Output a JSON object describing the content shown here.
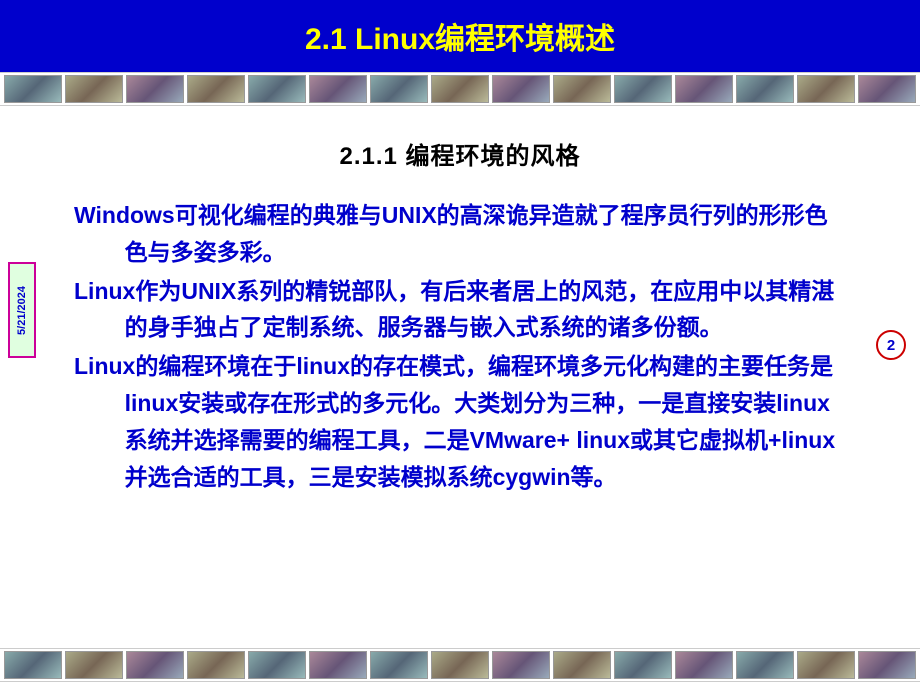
{
  "header": {
    "title": "2.1 Linux编程环境概述"
  },
  "subtitle": "2.1.1 编程环境的风格",
  "paragraphs": [
    "Windows可视化编程的典雅与UNIX的高深诡异造就了程序员行列的形形色色与多姿多彩。",
    "Linux作为UNIX系列的精锐部队，有后来者居上的风范，在应用中以其精湛的身手独占了定制系统、服务器与嵌入式系统的诸多份额。",
    "Linux的编程环境在于linux的存在模式，编程环境多元化构建的主要任务是linux安装或存在形式的多元化。大类划分为三种，一是直接安装linux系统并选择需要的编程工具，二是VMware+ linux或其它虚拟机+linux并选合适的工具，三是安装模拟系统cygwin等。"
  ],
  "meta": {
    "date": "5/21/2024",
    "page": "2"
  }
}
